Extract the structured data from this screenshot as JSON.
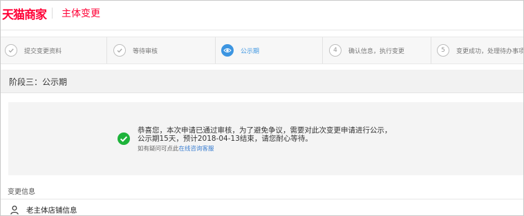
{
  "header": {
    "logo_text": "天猫商家",
    "title": "主体变更"
  },
  "steps": [
    {
      "label": "提交变更资料",
      "status": "done",
      "marker": "check-icon"
    },
    {
      "label": "等待审核",
      "status": "done",
      "marker": "check-icon"
    },
    {
      "label": "公示期",
      "status": "active",
      "marker": "eye-icon"
    },
    {
      "label": "确认信息，执行变更",
      "status": "pending",
      "number": "4"
    },
    {
      "label": "变更成功，处理待办事项",
      "status": "pending",
      "number": "5"
    }
  ],
  "stage": {
    "title": "阶段三：公示期"
  },
  "message": {
    "line1": "恭喜您，本次申请已通过审核，为了避免争议，需要对此次变更申请进行公示，",
    "line2": "公示期15天，预计2018-04-13结束，请您耐心等待。",
    "help_prefix": "如有疑问可点此",
    "help_link": "在线咨询客服"
  },
  "change_info": {
    "section_title": "变更信息",
    "old_store_title": "老主体店铺信息"
  },
  "colors": {
    "brand": "#ff0036",
    "accent": "#3c95e1",
    "success": "#1db33a",
    "link": "#3c7fd1"
  }
}
